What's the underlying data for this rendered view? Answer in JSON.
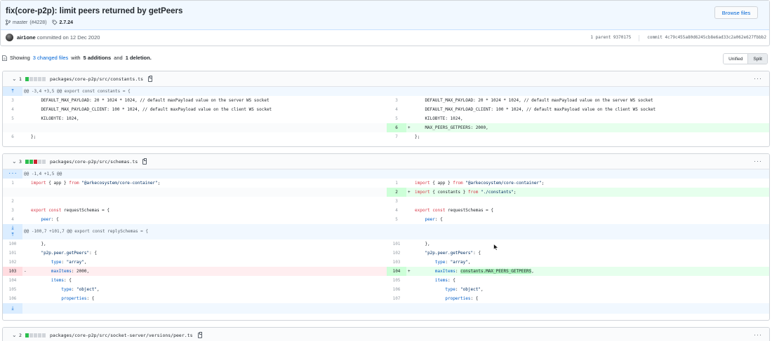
{
  "commit": {
    "title": "fix(core-p2p): limit peers returned by getPeers",
    "branch": "master",
    "pr": "(#4228)",
    "tag": "2.7.24",
    "browse_label": "Browse files",
    "author": "air1one",
    "committed_text": "committed on 12 Dec 2020",
    "parent_text": "1 parent 9370175",
    "commit_text": "commit 4c79c455a80d6245cb8e6ad33c2a062e627fbbb2"
  },
  "summary": {
    "prefix": "Showing",
    "changed_files": "3 changed files",
    "with": "with",
    "additions": "5 additions",
    "and": "and",
    "deletions": "1 deletion."
  },
  "view_toggle": {
    "unified": "Unified",
    "split": "Split"
  },
  "files": [
    {
      "count": "1",
      "path": "packages/core-p2p/src/constants.ts",
      "diffstat": [
        "add",
        "n",
        "n",
        "n",
        "n"
      ],
      "hunk": "@@ -3,4 +3,5 @@ export const constants = {",
      "rows": [
        {
          "l": {
            "n": "3",
            "c": "    DEFAULT_MAX_PAYLOAD: 20 * 1024 * 1024, // default maxPayload value on the server WS socket"
          },
          "r": {
            "n": "3",
            "c": "    DEFAULT_MAX_PAYLOAD: 20 * 1024 * 1024, // default maxPayload value on the server WS socket"
          }
        },
        {
          "l": {
            "n": "4",
            "c": "    DEFAULT_MAX_PAYLOAD_CLIENT: 100 * 1024, // default maxPayload value on the client WS socket"
          },
          "r": {
            "n": "4",
            "c": "    DEFAULT_MAX_PAYLOAD_CLIENT: 100 * 1024, // default maxPayload value on the client WS socket"
          }
        },
        {
          "l": {
            "n": "5",
            "c": "    KILOBYTE: 1024,"
          },
          "r": {
            "n": "5",
            "c": "    KILOBYTE: 1024,"
          }
        },
        {
          "l": {
            "n": "",
            "c": ""
          },
          "r": {
            "n": "6",
            "s": "+",
            "c": "    MAX_PEERS_GETPEERS: 2000,"
          }
        },
        {
          "l": {
            "n": "6",
            "c": "};"
          },
          "r": {
            "n": "7",
            "c": "};"
          }
        }
      ]
    },
    {
      "count": "3",
      "path": "packages/core-p2p/src/schemas.ts",
      "diffstat": [
        "add",
        "add",
        "del",
        "n",
        "n"
      ],
      "hunk1": "@@ -1,4 +1,5 @@",
      "rows1": [
        {
          "l": {
            "n": "1",
            "c": "import { app } from \"@arkecosystem/core-container\";"
          },
          "r": {
            "n": "1",
            "c": "import { app } from \"@arkecosystem/core-container\";"
          }
        },
        {
          "l": {
            "n": "",
            "c": ""
          },
          "r": {
            "n": "2",
            "s": "+",
            "c": "import { constants } from \"./constants\";"
          }
        },
        {
          "l": {
            "n": "2",
            "c": ""
          },
          "r": {
            "n": "3",
            "c": ""
          }
        },
        {
          "l": {
            "n": "3",
            "c": "export const requestSchemas = {"
          },
          "r": {
            "n": "4",
            "c": "export const requestSchemas = {"
          }
        },
        {
          "l": {
            "n": "4",
            "c": "    peer: {"
          },
          "r": {
            "n": "5",
            "c": "    peer: {"
          }
        }
      ],
      "hunk2": "@@ -100,7 +101,7 @@ export const replySchemas = {",
      "rows2": [
        {
          "l": {
            "n": "100",
            "c": "    },"
          },
          "r": {
            "n": "101",
            "c": "    },"
          }
        },
        {
          "l": {
            "n": "101",
            "c": "    \"p2p.peer.getPeers\": {"
          },
          "r": {
            "n": "102",
            "c": "    \"p2p.peer.getPeers\": {"
          }
        },
        {
          "l": {
            "n": "102",
            "c": "        type: \"array\","
          },
          "r": {
            "n": "103",
            "c": "        type: \"array\","
          }
        },
        {
          "l": {
            "n": "103",
            "s": "-",
            "c": "        maxItems: 2000,"
          },
          "r": {
            "n": "104",
            "s": "+",
            "c": "        maxItems: constants.MAX_PEERS_GETPEERS,"
          }
        },
        {
          "l": {
            "n": "104",
            "c": "        items: {"
          },
          "r": {
            "n": "105",
            "c": "        items: {"
          }
        },
        {
          "l": {
            "n": "105",
            "c": "            type: \"object\","
          },
          "r": {
            "n": "106",
            "c": "            type: \"object\","
          }
        },
        {
          "l": {
            "n": "106",
            "c": "            properties: {"
          },
          "r": {
            "n": "107",
            "c": "            properties: {"
          }
        }
      ]
    },
    {
      "count": "2",
      "path": "packages/core-p2p/src/socket-server/versions/peer.ts",
      "diffstat": [
        "add",
        "n",
        "n",
        "n",
        "n"
      ]
    }
  ],
  "icons": {
    "expand": "expand-icon",
    "copy": "copy-icon",
    "kebab": "kebab-icon",
    "chevron": "chevron-down-icon",
    "branch": "branch-icon",
    "tag": "tag-icon",
    "file": "file-diff-icon"
  },
  "colors": {
    "link": "#0366d6",
    "add_bg": "#e6ffed",
    "del_bg": "#ffeef0",
    "hunk_bg": "#f1f8ff"
  }
}
